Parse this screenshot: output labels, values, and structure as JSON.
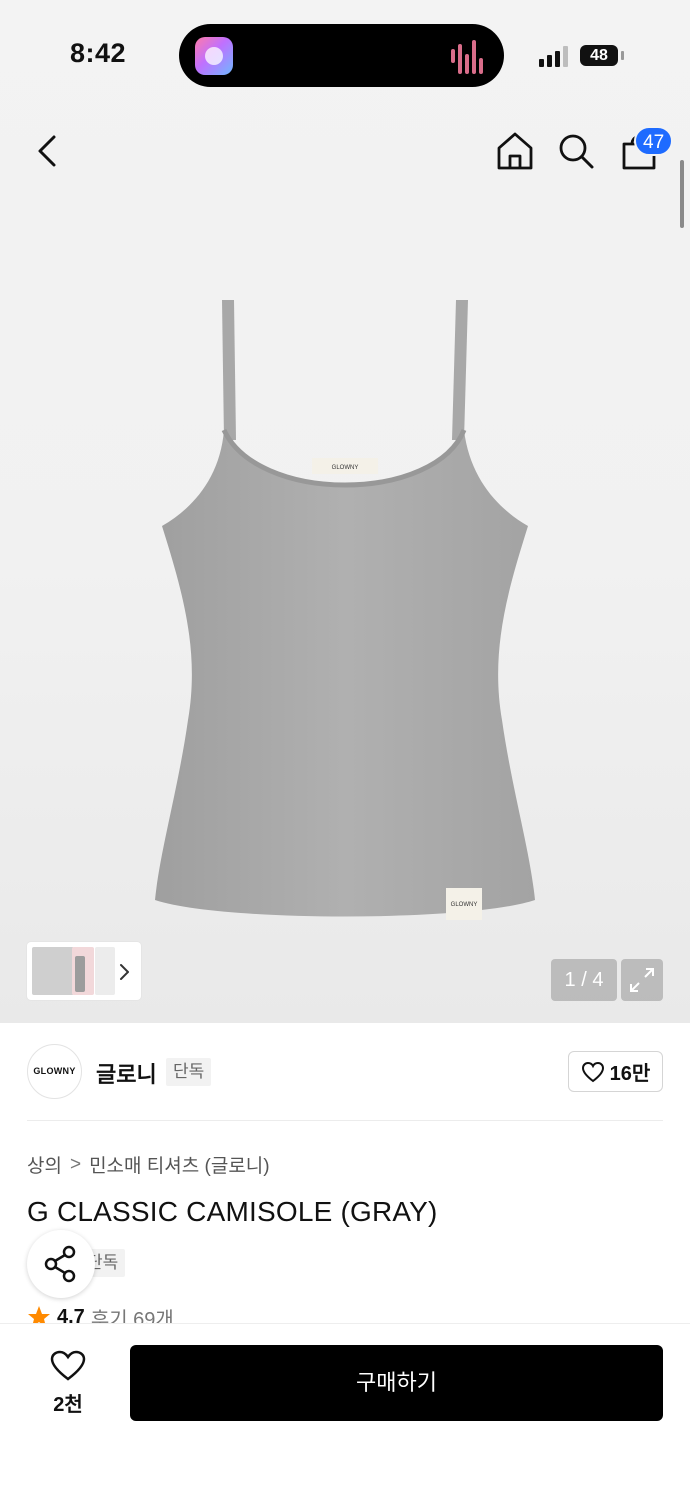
{
  "status_bar": {
    "time": "8:42",
    "battery": "48"
  },
  "nav": {
    "cart_count": "47"
  },
  "gallery": {
    "pager": "1 / 4"
  },
  "brand": {
    "logo_text": "GLOWNY",
    "name": "글로니",
    "tag": "단독",
    "likes": "16만"
  },
  "breadcrumb": {
    "category": "상의",
    "separator": ">",
    "subcategory": "민소매 티셔츠 (글로니)"
  },
  "product": {
    "label_text": "GLOWNY",
    "title": "G CLASSIC CAMISOLE (GRAY)",
    "exclusive_tag": "단독",
    "rating": "4.7",
    "reviews": "후기 69개"
  },
  "bottom": {
    "wish_count": "2천",
    "buy_label": "구매하기"
  },
  "icons": [
    "back-icon",
    "home-icon",
    "search-icon",
    "shopping-bag-icon",
    "chevron-right-icon",
    "expand-icon",
    "heart-icon",
    "share-icon",
    "star-icon"
  ],
  "colors": {
    "badge": "#1e6bff",
    "buy_button": "#000000",
    "star": "#ff8a00",
    "product": "#a9a9a9"
  }
}
